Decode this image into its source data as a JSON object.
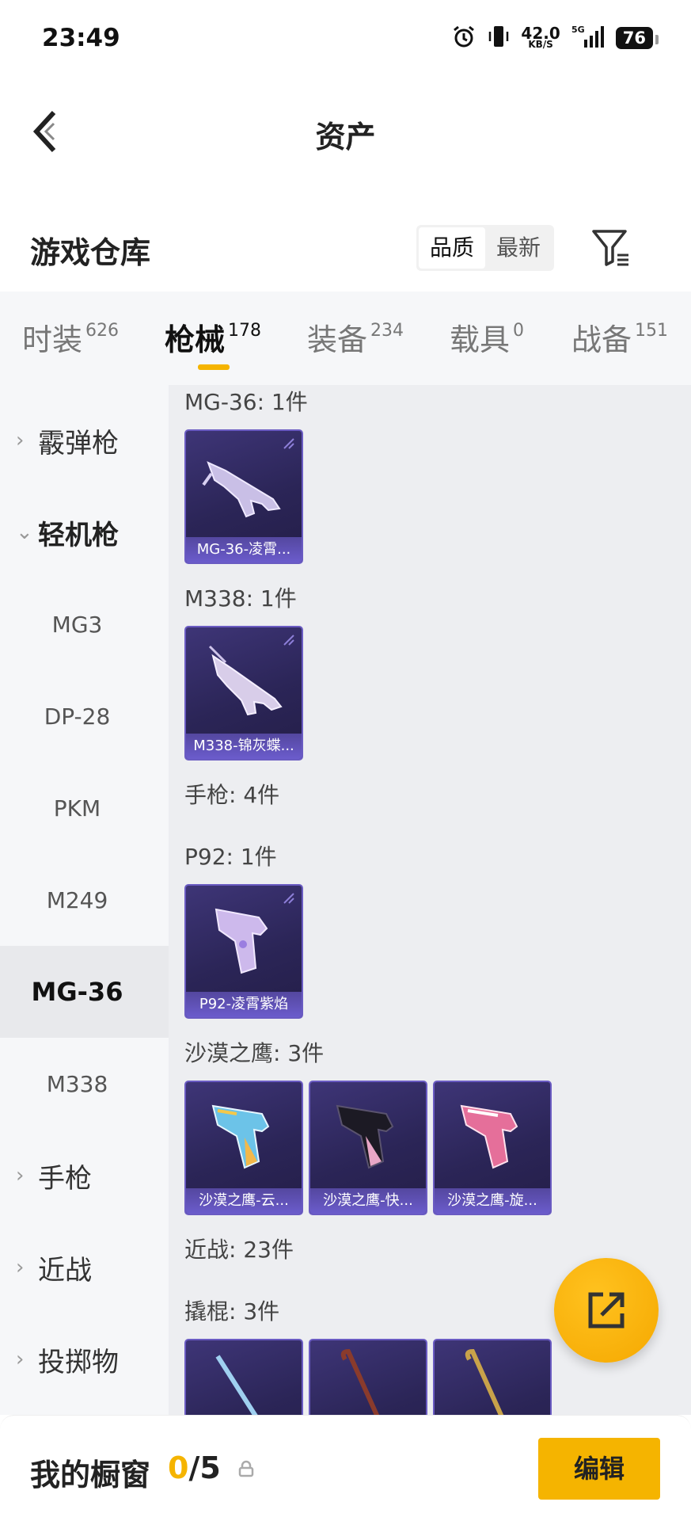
{
  "status_bar": {
    "time": "23:49",
    "net_speed": "42.0",
    "net_unit": "KB/S",
    "network": "5G",
    "battery": "76"
  },
  "header": {
    "title": "资产"
  },
  "toolbar": {
    "title": "游戏仓库",
    "sort_quality": "品质",
    "sort_latest": "最新"
  },
  "tabs": [
    {
      "label": "时装",
      "count": "626"
    },
    {
      "label": "枪械",
      "count": "178"
    },
    {
      "label": "装备",
      "count": "234"
    },
    {
      "label": "载具",
      "count": "0"
    },
    {
      "label": "战备",
      "count": "151"
    }
  ],
  "sidebar": {
    "groups": {
      "shotgun": "霰弹枪",
      "lmg": "轻机枪",
      "pistol": "手枪",
      "melee": "近战",
      "throwable": "投掷物"
    },
    "sub": [
      "MG3",
      "DP-28",
      "PKM",
      "M249",
      "MG-36",
      "M338"
    ]
  },
  "content": {
    "sections": [
      "MG-36: 1件",
      "M338: 1件",
      "手枪: 4件",
      "P92: 1件",
      "沙漠之鹰: 3件",
      "近战: 23件",
      "撬棍: 3件"
    ],
    "items": {
      "mg36": "MG-36-凌霄...",
      "m338": "M338-锦灰蝶...",
      "p92": "P92-凌霄紫焰",
      "de1": "沙漠之鹰-云...",
      "de2": "沙漠之鹰-快...",
      "de3": "沙漠之鹰-旋..."
    }
  },
  "bottom": {
    "label": "我的橱窗",
    "current": "0",
    "total": "/5",
    "edit": "编辑"
  },
  "colors": {
    "accent": "#f5b400",
    "card_bg": "#2b2557",
    "card_label": "#6b5ccc"
  }
}
